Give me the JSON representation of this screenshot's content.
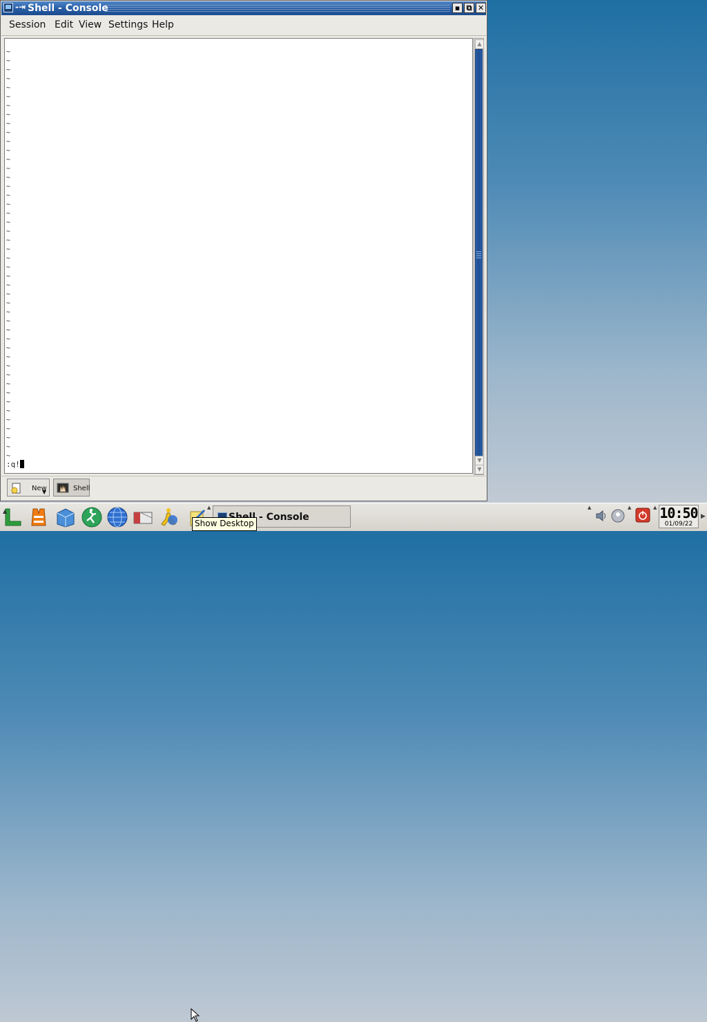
{
  "window": {
    "title": "Shell - Console",
    "pin_glyph": "-⇥",
    "buttons": {
      "minimize": "▪",
      "maximize": "⧉",
      "close": "✕"
    }
  },
  "menubar": {
    "items": [
      {
        "label": "Session"
      },
      {
        "label": "Edit"
      },
      {
        "label": "View"
      },
      {
        "label": "Settings"
      },
      {
        "label": "Help"
      }
    ]
  },
  "terminal": {
    "tilde_char": "~",
    "tilde_count": 46,
    "command": ":q!"
  },
  "session_tabs": {
    "new_label": "New",
    "shell_label": "Shell"
  },
  "taskbar": {
    "launchers": [
      "kde-menu-icon",
      "lifejacket-help-icon",
      "home-folder-icon",
      "konsole-run-icon",
      "browser-globe-icon",
      "mail-icon",
      "aim-messenger-icon",
      "show-desktop-icon"
    ],
    "task_button_label": "Shell - Console",
    "tray": [
      "volume-icon",
      "network-icon",
      "power-icon"
    ]
  },
  "clock": {
    "time": "10:50",
    "date": "01/09/22"
  },
  "tooltip": {
    "text": "Show Desktop"
  },
  "colors": {
    "titlebar": "#2a5fa5",
    "scroll_thumb": "#1e4f94",
    "desktop_top": "#1f6fa3",
    "tooltip_bg": "#ffffe1"
  }
}
